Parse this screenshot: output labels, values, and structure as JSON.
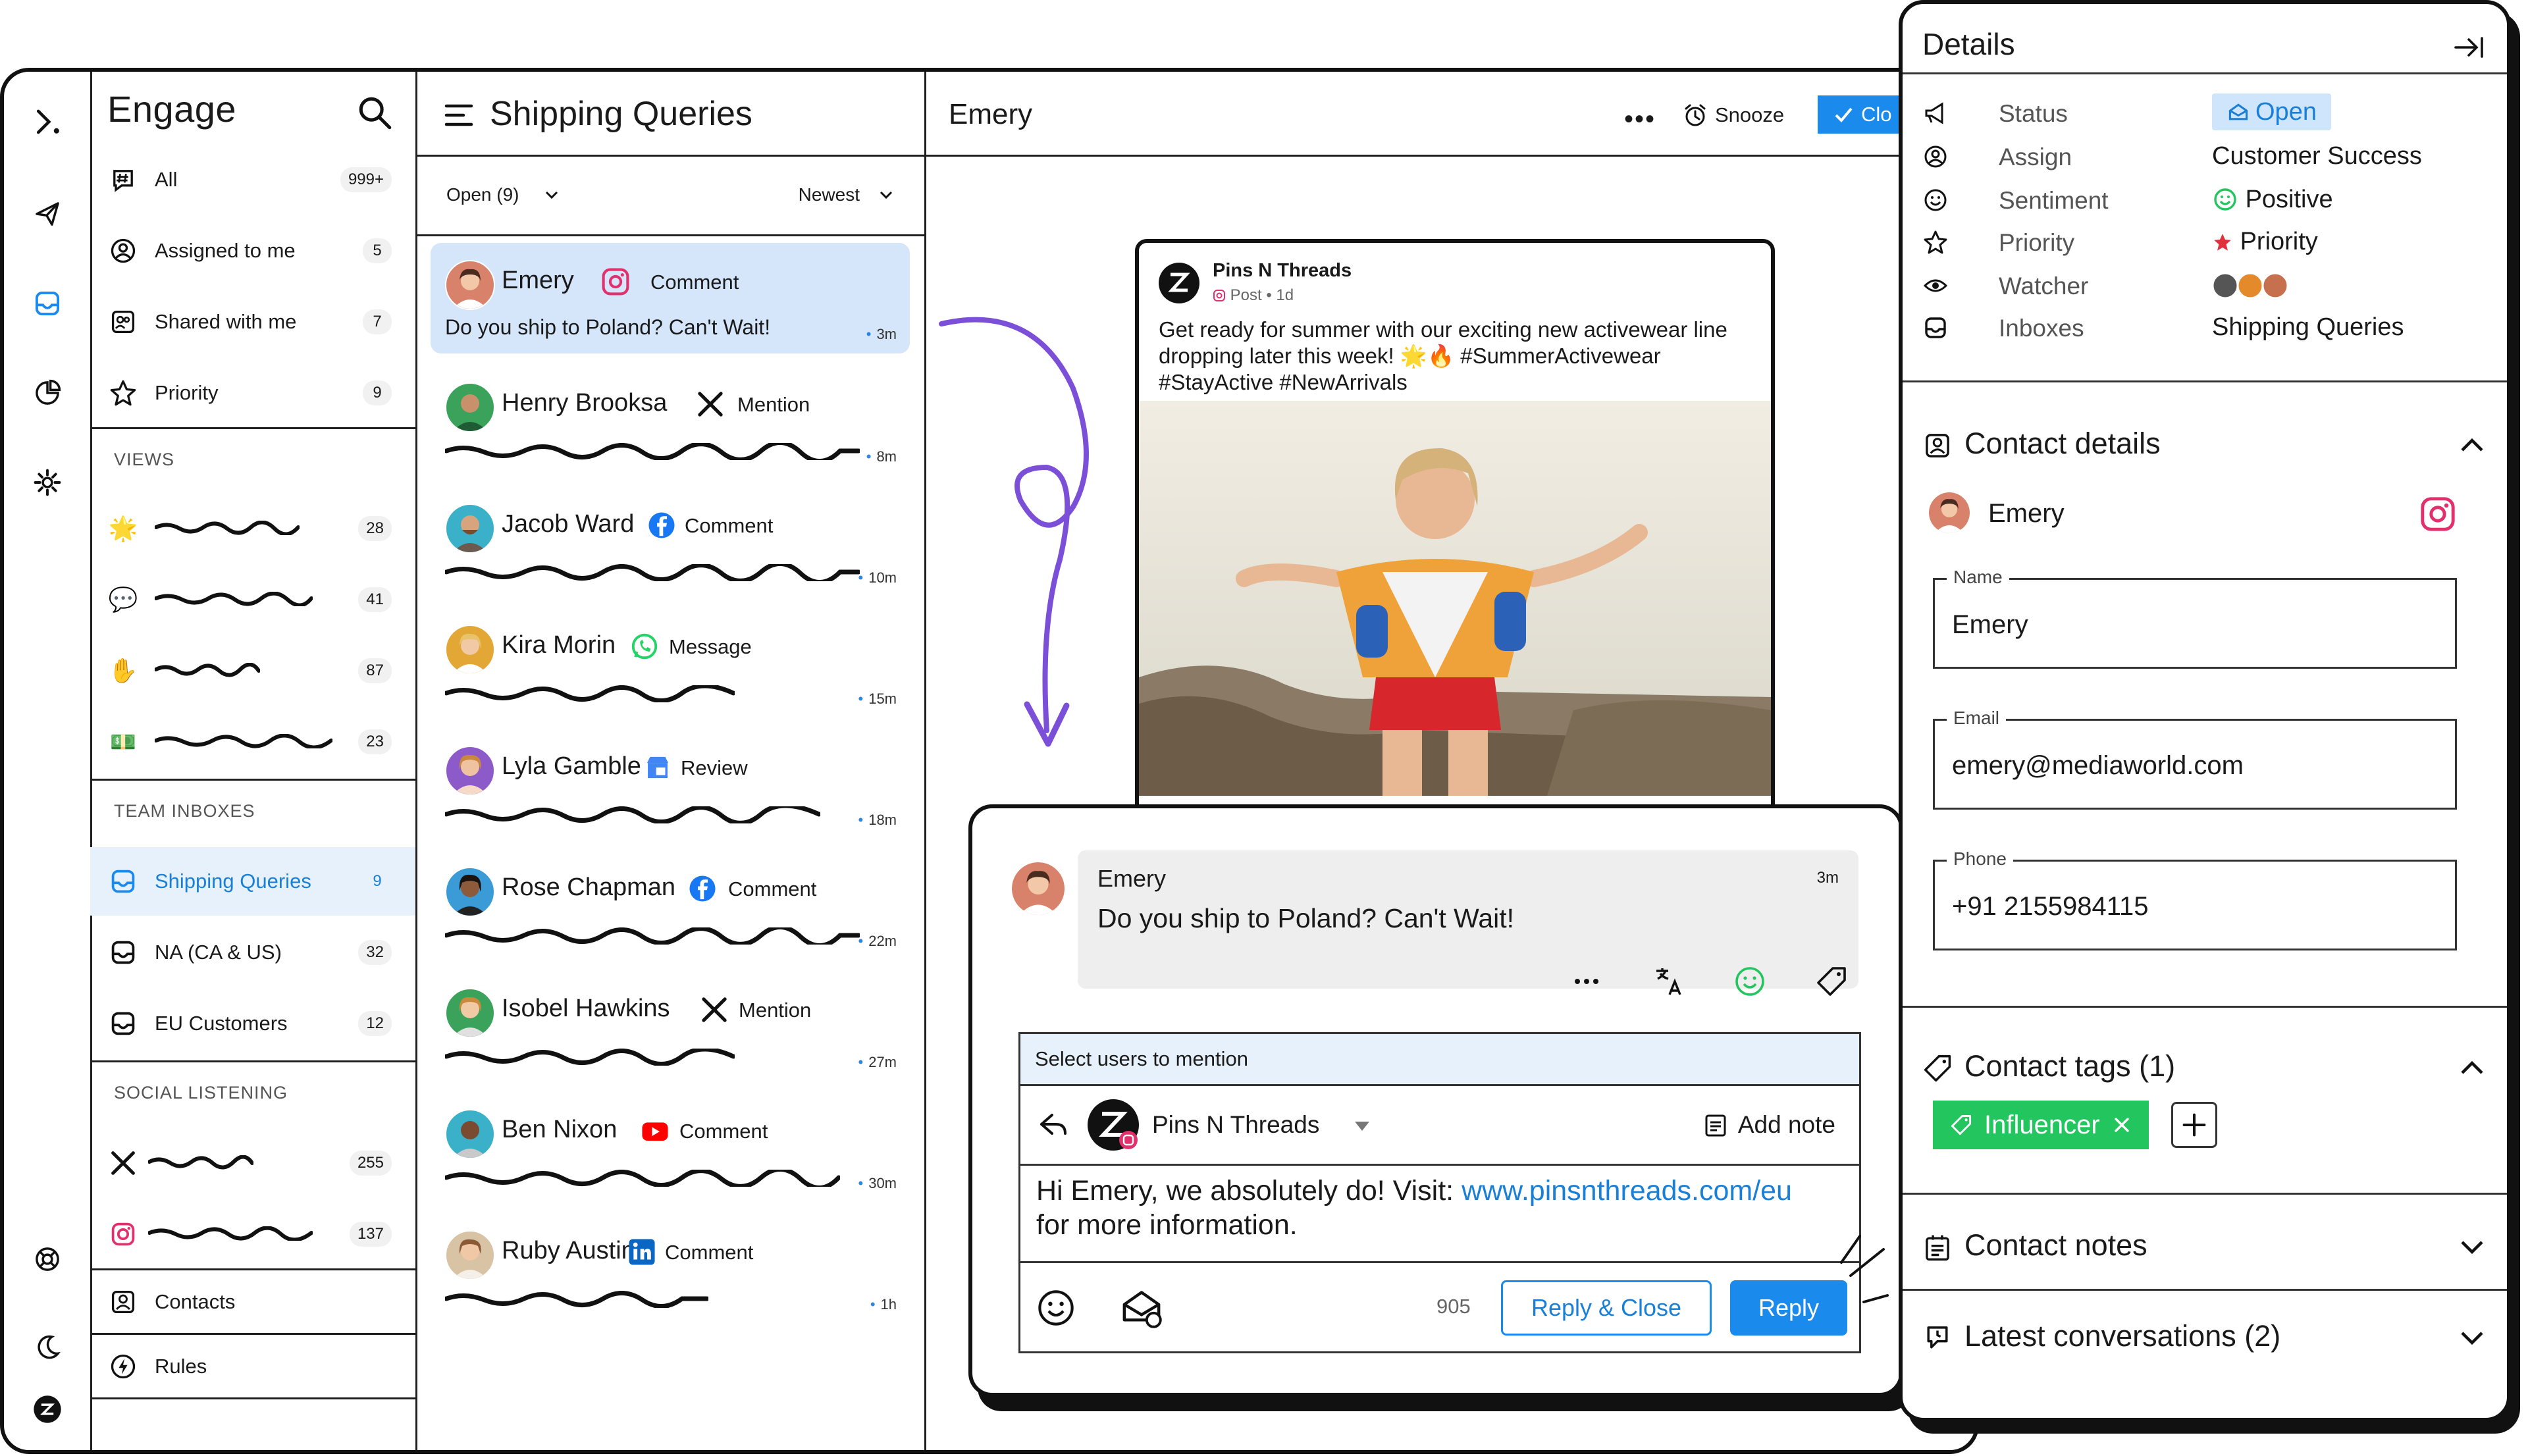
{
  "engage": {
    "title": "Engage",
    "nav": [
      {
        "label": "All",
        "count": "999+"
      },
      {
        "label": "Assigned to me",
        "count": "5"
      },
      {
        "label": "Shared with me",
        "count": "7"
      },
      {
        "label": "Priority",
        "count": "9"
      }
    ],
    "views_header": "VIEWS",
    "views": [
      {
        "emoji": "🌟",
        "count": "28"
      },
      {
        "emoji": "💬",
        "count": "41"
      },
      {
        "emoji": "✋",
        "count": "87"
      },
      {
        "emoji": "💵",
        "count": "23"
      }
    ],
    "team_header": "TEAM INBOXES",
    "team_inboxes": [
      {
        "label": "Shipping Queries",
        "count": "9"
      },
      {
        "label": "NA (CA & US)",
        "count": "32"
      },
      {
        "label": "EU Customers",
        "count": "12"
      }
    ],
    "social_header": "SOCIAL LISTENING",
    "social": [
      {
        "icon": "x-icon",
        "count": "255"
      },
      {
        "icon": "instagram-icon",
        "count": "137"
      }
    ],
    "contacts_label": "Contacts",
    "rules_label": "Rules"
  },
  "list": {
    "title": "Shipping Queries",
    "filter_status": "Open (9)",
    "filter_sort": "Newest",
    "items": [
      {
        "name": "Emery",
        "kind": "Comment",
        "source": "instagram",
        "preview": "Do you ship to Poland? Can't Wait!",
        "time": "3m",
        "selected": true,
        "avatar_color": "#d9826b"
      },
      {
        "name": "Henry Brooksa",
        "kind": "Mention",
        "source": "x",
        "time": "8m",
        "avatar_color": "#3aa25b"
      },
      {
        "name": "Jacob Ward",
        "kind": "Comment",
        "source": "facebook",
        "time": "10m",
        "avatar_color": "#3ab0c9"
      },
      {
        "name": "Kira Morin",
        "kind": "Message",
        "source": "whatsapp",
        "time": "15m",
        "avatar_color": "#e3a735"
      },
      {
        "name": "Lyla Gamble",
        "kind": "Review",
        "source": "gmb",
        "time": "18m",
        "avatar_color": "#8d5ac9"
      },
      {
        "name": "Rose Chapman",
        "kind": "Comment",
        "source": "facebook",
        "time": "22m",
        "avatar_color": "#3a9bd6"
      },
      {
        "name": "Isobel Hawkins",
        "kind": "Mention",
        "source": "x",
        "time": "27m",
        "avatar_color": "#3aa25b"
      },
      {
        "name": "Ben Nixon",
        "kind": "Comment",
        "source": "youtube",
        "time": "30m",
        "avatar_color": "#3ab0c9"
      },
      {
        "name": "Ruby Austin",
        "kind": "Comment",
        "source": "linkedin",
        "time": "1h",
        "avatar_color": "#d8c3a5"
      }
    ]
  },
  "conversation": {
    "contact_name": "Emery",
    "more_label": "•••",
    "snooze_label": "Snooze",
    "close_label": "Clo"
  },
  "post": {
    "author": "Pins N Threads",
    "meta": "Post • 1d",
    "text": "Get ready for summer with our exciting new activewear line dropping later this week! 🌟🔥 #SummerActivewear #StayActive #NewArrivals"
  },
  "message": {
    "name": "Emery",
    "time": "3m",
    "text": "Do you ship to Poland? Can't Wait!"
  },
  "composer": {
    "mention_prompt": "Select users to mention",
    "sender": "Pins N Threads",
    "add_note": "Add note",
    "reply_prefix": "Hi Emery, we absolutely do! Visit: ",
    "reply_link": "www.pinsnthreads.com/eu",
    "reply_suffix": "for more information.",
    "char_count": "905",
    "reply_close_label": "Reply & Close",
    "reply_label": "Reply"
  },
  "details": {
    "title": "Details",
    "rows": [
      {
        "key": "Status",
        "value": "Open"
      },
      {
        "key": "Assign",
        "value": "Customer Success"
      },
      {
        "key": "Sentiment",
        "value": "Positive"
      },
      {
        "key": "Priority",
        "value": "Priority"
      },
      {
        "key": "Watcher",
        "value": ""
      },
      {
        "key": "Inboxes",
        "value": "Shipping Queries"
      }
    ],
    "contact_header": "Contact details",
    "contact_name": "Emery",
    "name_label": "Name",
    "name_value": "Emery",
    "email_label": "Email",
    "email_value": "emery@mediaworld.com",
    "phone_label": "Phone",
    "phone_value": "+91 2155984115",
    "tags_header": "Contact tags (1)",
    "tag": "Influencer",
    "notes_header": "Contact notes",
    "latest_header": "Latest conversations (2)"
  },
  "colors": {
    "accent": "#1a8bed",
    "selected_bg": "#d5e6fa",
    "tag_green": "#22c55e",
    "status_bg": "#cfe5fb"
  }
}
